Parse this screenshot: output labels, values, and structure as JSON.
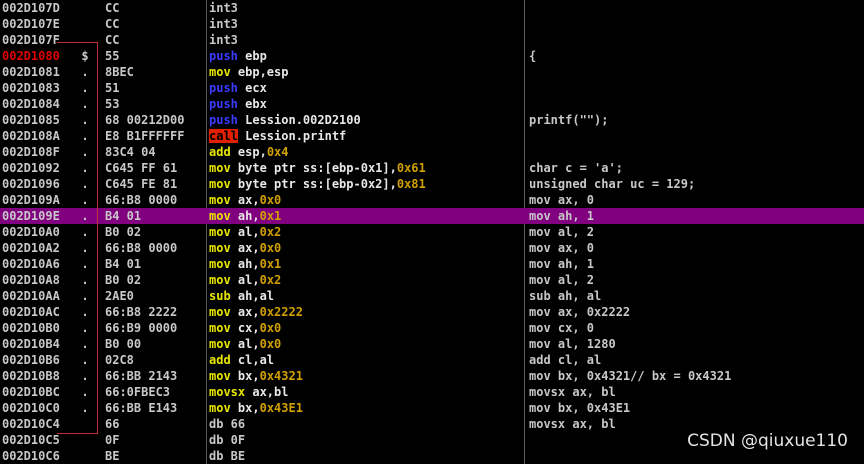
{
  "palette": {
    "background": "#000000",
    "selected_row": "#800080",
    "normal": "#c8c8c8",
    "mnemonic_default": "#e8e8e8",
    "mnemonic_yellow": "#e8e800",
    "mnemonic_blue": "#3b3bff",
    "operand_number": "#d0a000",
    "call_background": "#e02000",
    "call_text": "#000000",
    "entry_address": "#e00000",
    "bracket": "#c03030",
    "watermark": "#e4e4e4"
  },
  "rows": [
    {
      "address": "002D107D",
      "mark": "",
      "hex": "CC",
      "asm": [
        {
          "t": "int3",
          "k": "padding"
        }
      ],
      "comment": ""
    },
    {
      "address": "002D107E",
      "mark": "",
      "hex": "CC",
      "asm": [
        {
          "t": "int3",
          "k": "padding"
        }
      ],
      "comment": ""
    },
    {
      "address": "002D107F",
      "mark": "",
      "hex": "CC",
      "asm": [
        {
          "t": "int3",
          "k": "padding"
        }
      ],
      "comment": ""
    },
    {
      "address": "002D1080",
      "mark": "$",
      "hex": "55",
      "entry": true,
      "asm": [
        {
          "t": "push",
          "k": "stack"
        },
        {
          "t": " ebp",
          "k": "reg"
        }
      ],
      "comment": "{"
    },
    {
      "address": "002D1081",
      "mark": ".",
      "hex": "8BEC",
      "asm": [
        {
          "t": "mov",
          "k": "move"
        },
        {
          "t": " ebp,esp",
          "k": "reg"
        }
      ],
      "comment": ""
    },
    {
      "address": "002D1083",
      "mark": ".",
      "hex": "51",
      "asm": [
        {
          "t": "push",
          "k": "stack"
        },
        {
          "t": " ecx",
          "k": "reg"
        }
      ],
      "comment": ""
    },
    {
      "address": "002D1084",
      "mark": ".",
      "hex": "53",
      "asm": [
        {
          "t": "push",
          "k": "stack"
        },
        {
          "t": " ebx",
          "k": "reg"
        }
      ],
      "comment": ""
    },
    {
      "address": "002D1085",
      "mark": ".",
      "hex": "68 00212D00",
      "asm": [
        {
          "t": "push",
          "k": "stack"
        },
        {
          "t": " Lession.002D2100",
          "k": "plain"
        }
      ],
      "comment": "printf(\"\");"
    },
    {
      "address": "002D108A",
      "mark": ".",
      "hex": "E8 B1FFFFFF",
      "asm": [
        {
          "t": "call",
          "k": "call"
        },
        {
          "t": " Lession.printf",
          "k": "plain"
        }
      ],
      "comment": ""
    },
    {
      "address": "002D108F",
      "mark": ".",
      "hex": "83C4 04",
      "asm": [
        {
          "t": "add",
          "k": "arith"
        },
        {
          "t": " esp,",
          "k": "reg"
        },
        {
          "t": "0x4",
          "k": "num"
        }
      ],
      "comment": ""
    },
    {
      "address": "002D1092",
      "mark": ".",
      "hex": "C645 FF 61",
      "asm": [
        {
          "t": "mov",
          "k": "move"
        },
        {
          "t": " byte ptr ss:[ebp-0x1],",
          "k": "reg"
        },
        {
          "t": "0x61",
          "k": "num"
        }
      ],
      "comment": "char c = 'a';"
    },
    {
      "address": "002D1096",
      "mark": ".",
      "hex": "C645 FE 81",
      "asm": [
        {
          "t": "mov",
          "k": "move"
        },
        {
          "t": " byte ptr ss:[ebp-0x2],",
          "k": "reg"
        },
        {
          "t": "0x81",
          "k": "num"
        }
      ],
      "comment": "unsigned char uc = 129;"
    },
    {
      "address": "002D109A",
      "mark": ".",
      "hex": "66:B8 0000",
      "asm": [
        {
          "t": "mov",
          "k": "move"
        },
        {
          "t": " ax,",
          "k": "reg"
        },
        {
          "t": "0x0",
          "k": "num"
        }
      ],
      "comment": "mov ax, 0"
    },
    {
      "address": "002D109E",
      "mark": ".",
      "hex": "B4 01",
      "selected": true,
      "asm": [
        {
          "t": "mov",
          "k": "move"
        },
        {
          "t": " ah,",
          "k": "reg"
        },
        {
          "t": "0x1",
          "k": "num"
        }
      ],
      "comment": "mov ah, 1"
    },
    {
      "address": "002D10A0",
      "mark": ".",
      "hex": "B0 02",
      "asm": [
        {
          "t": "mov",
          "k": "move"
        },
        {
          "t": " al,",
          "k": "reg"
        },
        {
          "t": "0x2",
          "k": "num"
        }
      ],
      "comment": "mov al, 2"
    },
    {
      "address": "002D10A2",
      "mark": ".",
      "hex": "66:B8 0000",
      "asm": [
        {
          "t": "mov",
          "k": "move"
        },
        {
          "t": " ax,",
          "k": "reg"
        },
        {
          "t": "0x0",
          "k": "num"
        }
      ],
      "comment": "mov ax, 0"
    },
    {
      "address": "002D10A6",
      "mark": ".",
      "hex": "B4 01",
      "asm": [
        {
          "t": "mov",
          "k": "move"
        },
        {
          "t": " ah,",
          "k": "reg"
        },
        {
          "t": "0x1",
          "k": "num"
        }
      ],
      "comment": "mov ah, 1"
    },
    {
      "address": "002D10A8",
      "mark": ".",
      "hex": "B0 02",
      "asm": [
        {
          "t": "mov",
          "k": "move"
        },
        {
          "t": " al,",
          "k": "reg"
        },
        {
          "t": "0x2",
          "k": "num"
        }
      ],
      "comment": "mov al, 2"
    },
    {
      "address": "002D10AA",
      "mark": ".",
      "hex": "2AE0",
      "asm": [
        {
          "t": "sub",
          "k": "arith"
        },
        {
          "t": " ah,al",
          "k": "reg"
        }
      ],
      "comment": "sub ah, al"
    },
    {
      "address": "002D10AC",
      "mark": ".",
      "hex": "66:B8 2222",
      "asm": [
        {
          "t": "mov",
          "k": "move"
        },
        {
          "t": " ax,",
          "k": "reg"
        },
        {
          "t": "0x2222",
          "k": "num"
        }
      ],
      "comment": "mov ax, 0x2222"
    },
    {
      "address": "002D10B0",
      "mark": ".",
      "hex": "66:B9 0000",
      "asm": [
        {
          "t": "mov",
          "k": "move"
        },
        {
          "t": " cx,",
          "k": "reg"
        },
        {
          "t": "0x0",
          "k": "num"
        }
      ],
      "comment": "mov cx, 0"
    },
    {
      "address": "002D10B4",
      "mark": ".",
      "hex": "B0 00",
      "asm": [
        {
          "t": "mov",
          "k": "move"
        },
        {
          "t": " al,",
          "k": "reg"
        },
        {
          "t": "0x0",
          "k": "num"
        }
      ],
      "comment": "mov al, 1280"
    },
    {
      "address": "002D10B6",
      "mark": ".",
      "hex": "02C8",
      "asm": [
        {
          "t": "add",
          "k": "arith"
        },
        {
          "t": " cl,al",
          "k": "reg"
        }
      ],
      "comment": "add cl, al"
    },
    {
      "address": "002D10B8",
      "mark": ".",
      "hex": "66:BB 2143",
      "asm": [
        {
          "t": "mov",
          "k": "move"
        },
        {
          "t": " bx,",
          "k": "reg"
        },
        {
          "t": "0x4321",
          "k": "num"
        }
      ],
      "comment": "mov bx, 0x4321// bx = 0x4321"
    },
    {
      "address": "002D10BC",
      "mark": ".",
      "hex": "66:0FBEC3",
      "asm": [
        {
          "t": "movsx",
          "k": "move"
        },
        {
          "t": " ax,bl",
          "k": "reg"
        }
      ],
      "comment": "movsx ax, bl"
    },
    {
      "address": "002D10C0",
      "mark": ".",
      "hex": "66:BB E143",
      "asm": [
        {
          "t": "mov",
          "k": "move"
        },
        {
          "t": " bx,",
          "k": "reg"
        },
        {
          "t": "0x43E1",
          "k": "num"
        }
      ],
      "comment": "mov bx, 0x43E1"
    },
    {
      "address": "002D10C4",
      "mark": "",
      "hex": "66",
      "asm": [
        {
          "t": "db 66",
          "k": "padding"
        }
      ],
      "comment": "movsx ax, bl"
    },
    {
      "address": "002D10C5",
      "mark": "",
      "hex": "0F",
      "asm": [
        {
          "t": "db 0F",
          "k": "padding"
        }
      ],
      "comment": ""
    },
    {
      "address": "002D10C6",
      "mark": "",
      "hex": "BE",
      "asm": [
        {
          "t": "db BE",
          "k": "padding"
        }
      ],
      "comment": ""
    }
  ],
  "watermark": {
    "text": "CSDN @qiuxue110"
  }
}
